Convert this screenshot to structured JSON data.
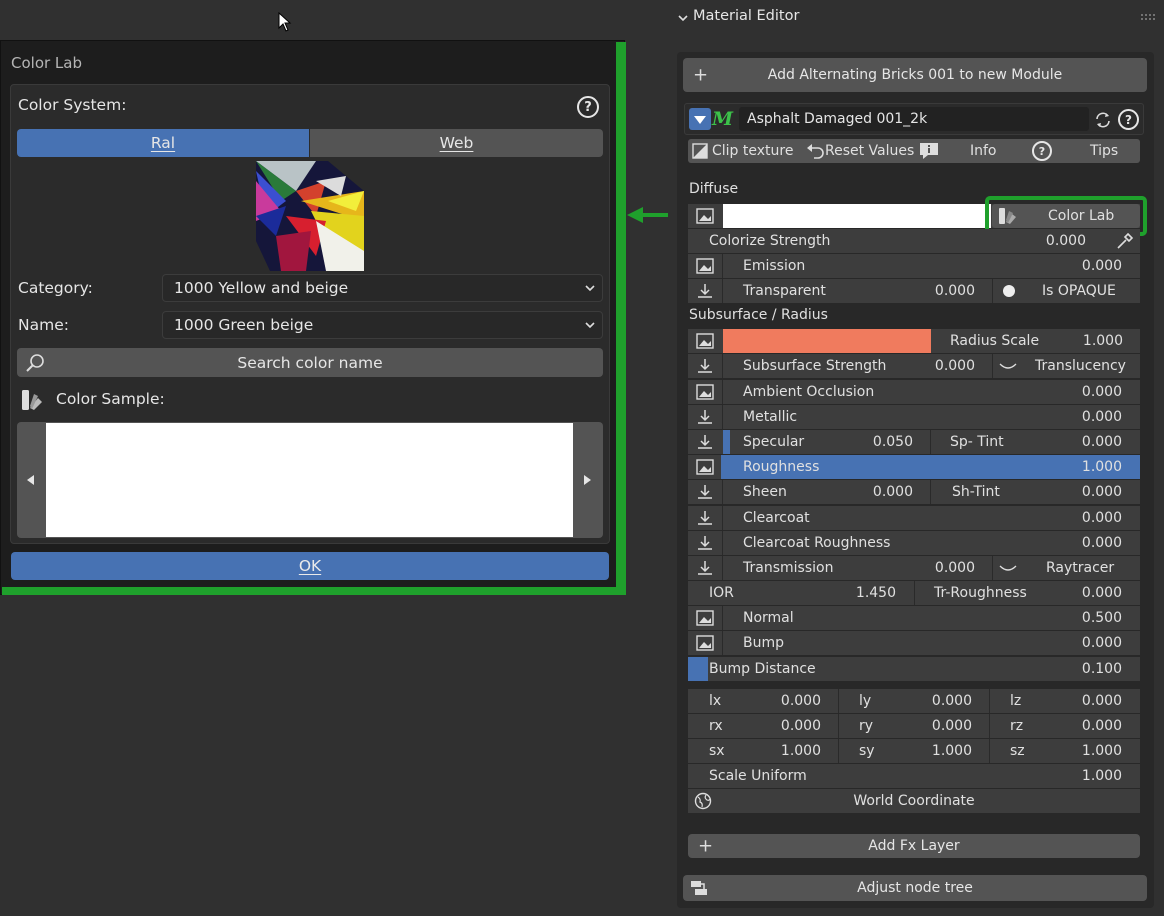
{
  "popup": {
    "title": "Color Lab",
    "color_system_label": "Color System:",
    "tabs": [
      "Ral",
      "Web"
    ],
    "active_tab": "Ral",
    "category_label": "Category:",
    "category_value": "1000 Yellow and beige",
    "name_label": "Name:",
    "name_value": "1000 Green beige",
    "search_label": "Search color name",
    "color_sample_label": "Color Sample:",
    "ok_label": "OK"
  },
  "material_editor": {
    "header": "Material Editor",
    "add_module_label": "Add Alternating Bricks 001 to new Module",
    "material_name": "Asphalt Damaged 001_2k",
    "toolbar": {
      "clip_texture": "Clip texture",
      "reset_values": "Reset Values",
      "info": "Info",
      "tips": "Tips"
    },
    "diffuse_section": "Diffuse",
    "color_lab_button": "Color Lab",
    "colorize_strength": {
      "label": "Colorize Strength",
      "value": "0.000"
    },
    "emission": {
      "label": "Emission",
      "value": "0.000"
    },
    "transparent": {
      "label": "Transparent",
      "value": "0.000",
      "opaque_label": "Is OPAQUE"
    },
    "subsurface_section": "Subsurface / Radius",
    "radius_color": "#f07b5e",
    "radius_scale": {
      "label": "Radius Scale",
      "value": "1.000"
    },
    "subsurface_strength": {
      "label": "Subsurface Strength",
      "value": "0.000",
      "translucency_label": "Translucency"
    },
    "ambient_occlusion": {
      "label": "Ambient Occlusion",
      "value": "0.000"
    },
    "metallic": {
      "label": "Metallic",
      "value": "0.000"
    },
    "specular": {
      "label": "Specular",
      "value": "0.050",
      "tint_label": "Sp- Tint",
      "tint_value": "0.000"
    },
    "roughness": {
      "label": "Roughness",
      "value": "1.000"
    },
    "sheen": {
      "label": "Sheen",
      "value": "0.000",
      "tint_label": "Sh-Tint",
      "tint_value": "0.000"
    },
    "clearcoat": {
      "label": "Clearcoat",
      "value": "0.000"
    },
    "clearcoat_roughness": {
      "label": "Clearcoat Roughness",
      "value": "0.000"
    },
    "transmission": {
      "label": "Transmission",
      "value": "0.000",
      "raytracer_label": "Raytracer"
    },
    "ior": {
      "label": "IOR",
      "value": "1.450",
      "tr_label": "Tr-Roughness",
      "tr_value": "0.000"
    },
    "normal": {
      "label": "Normal",
      "value": "0.500"
    },
    "bump": {
      "label": "Bump",
      "value": "0.000"
    },
    "bump_distance": {
      "label": "Bump Distance",
      "value": "0.100"
    },
    "transform": {
      "lx": "0.000",
      "ly": "0.000",
      "lz": "0.000",
      "rx": "0.000",
      "ry": "0.000",
      "rz": "0.000",
      "sx": "1.000",
      "sy": "1.000",
      "sz": "1.000",
      "labels": {
        "lx": "lx",
        "ly": "ly",
        "lz": "lz",
        "rx": "rx",
        "ry": "ry",
        "rz": "rz",
        "sx": "sx",
        "sy": "sy",
        "sz": "sz"
      }
    },
    "scale_uniform": {
      "label": "Scale Uniform",
      "value": "1.000"
    },
    "world_coordinate_label": "World Coordinate",
    "add_fx_layer_label": "Add Fx Layer",
    "adjust_node_tree_label": "Adjust node tree"
  },
  "colors": {
    "accent": "#4772b3",
    "highlight_green": "#1fa02c"
  }
}
